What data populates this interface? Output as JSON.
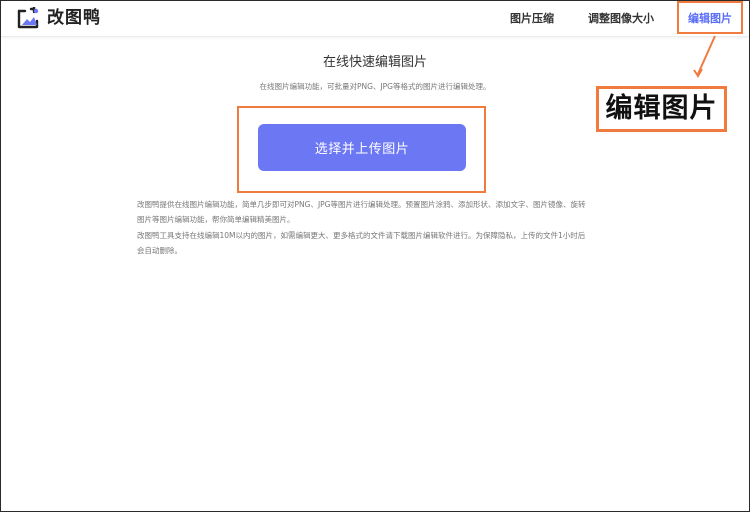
{
  "header": {
    "logo_text": "改图鸭",
    "nav": {
      "compress": "图片压缩",
      "resize": "调整图像大小",
      "edit": "编辑图片"
    }
  },
  "callout": {
    "text": "编辑图片"
  },
  "main": {
    "title": "在线快速编辑图片",
    "subtitle": "在线图片编辑功能，可批量对PNG、JPG等格式的图片进行编辑处理。",
    "upload_button": "选择并上传图片",
    "description": [
      "改图鸭提供在线图片编辑功能，简单几步即可对PNG、JPG等图片进行编辑处理。预置图片涂鸦、添加形状、添加文字、图片镜像、旋转图片等图片编辑功能，帮你简单编辑精美图片。",
      "改图鸭工具支持在线编辑10M以内的图片，如需编辑更大、更多格式的文件请下载图片编辑软件进行。为保障隐私，上传的文件1小时后会自动删除。"
    ]
  },
  "colors": {
    "accent": "#6c77f4",
    "nav_active": "#5b6ef7",
    "annotation": "#f07b3f"
  },
  "icons": {
    "logo": "image-frame-icon"
  }
}
